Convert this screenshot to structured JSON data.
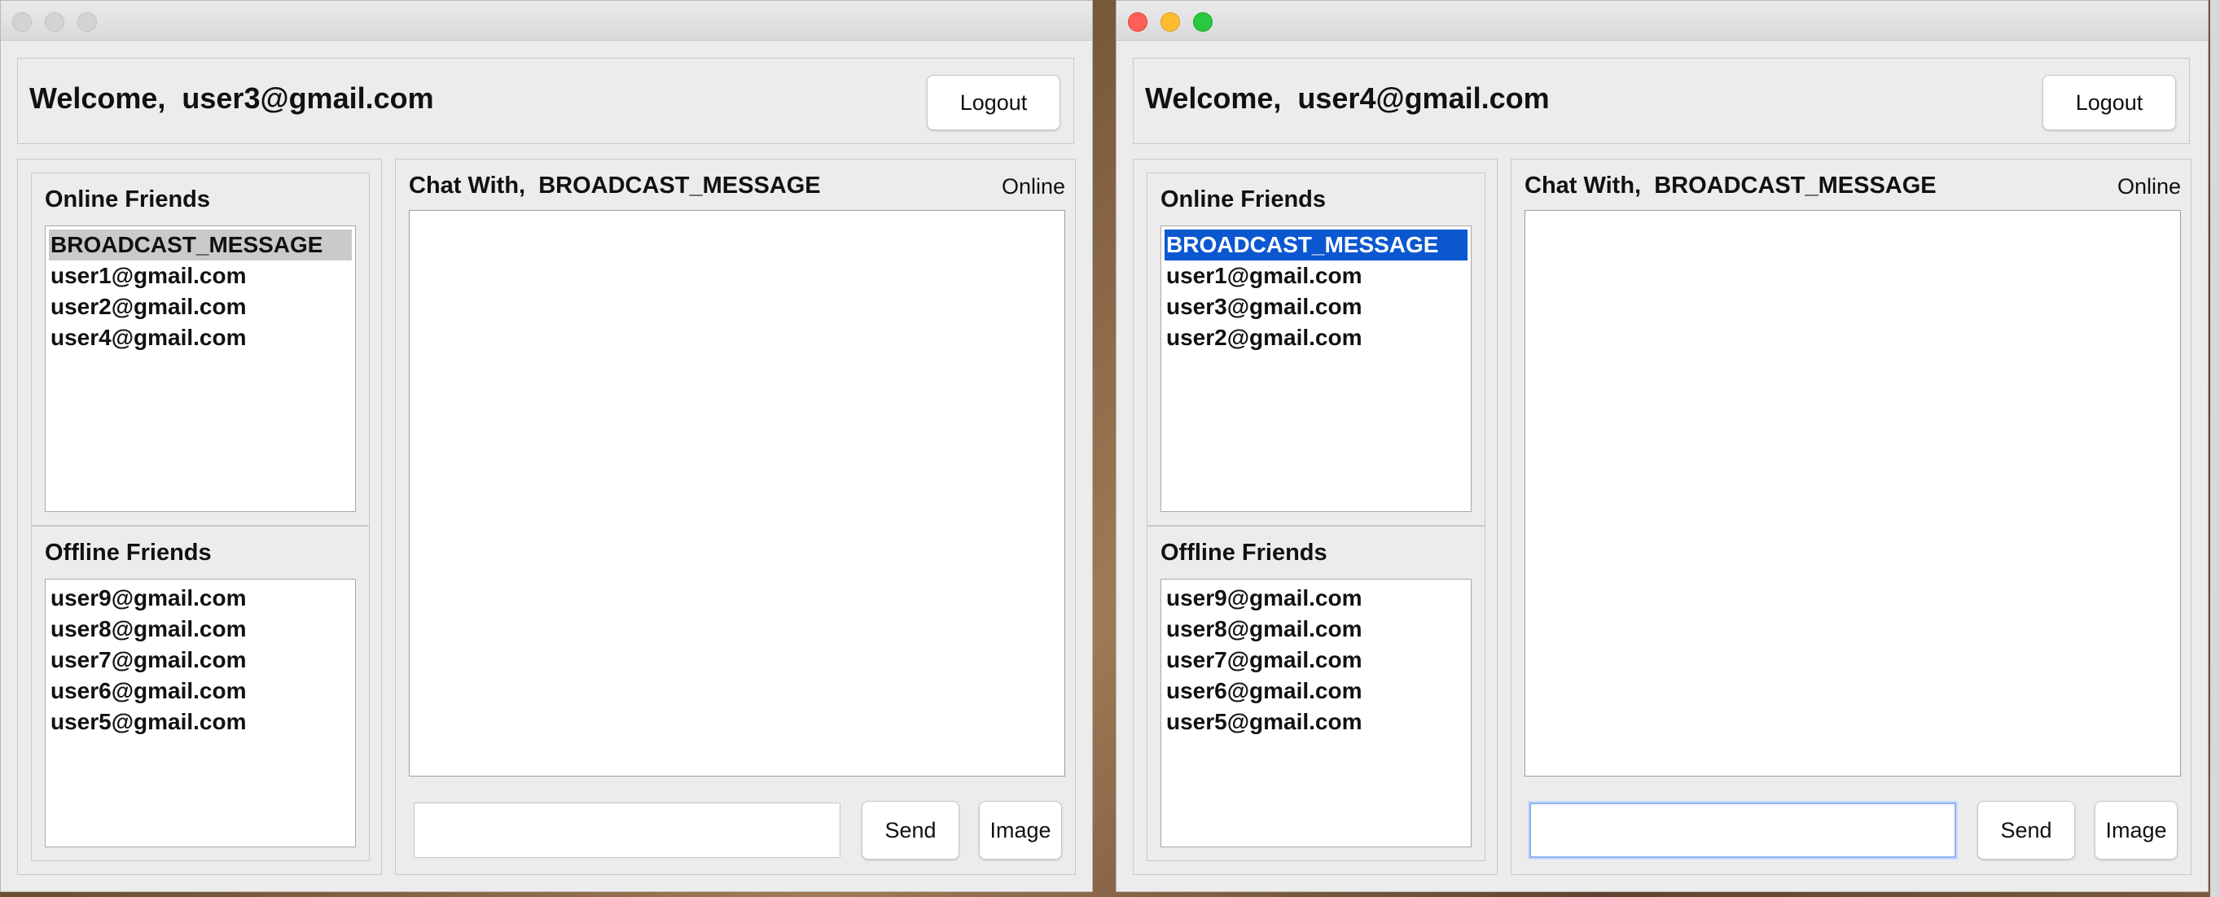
{
  "windows": [
    {
      "welcome": "Welcome,  user3@gmail.com",
      "logout": "Logout",
      "online_title": "Online Friends",
      "online": [
        "BROADCAST_MESSAGE",
        "user1@gmail.com",
        "user2@gmail.com",
        "user4@gmail.com"
      ],
      "offline_title": "Offline Friends",
      "offline": [
        "user9@gmail.com",
        "user8@gmail.com",
        "user7@gmail.com",
        "user6@gmail.com",
        "user5@gmail.com"
      ],
      "chat_title": "Chat With,  BROADCAST_MESSAGE",
      "status": "Online",
      "message_value": "",
      "send": "Send",
      "image": "Image"
    },
    {
      "welcome": "Welcome,  user4@gmail.com",
      "logout": "Logout",
      "online_title": "Online Friends",
      "online": [
        "BROADCAST_MESSAGE",
        "user1@gmail.com",
        "user3@gmail.com",
        "user2@gmail.com"
      ],
      "offline_title": "Offline Friends",
      "offline": [
        "user9@gmail.com",
        "user8@gmail.com",
        "user7@gmail.com",
        "user6@gmail.com",
        "user5@gmail.com"
      ],
      "chat_title": "Chat With,  BROADCAST_MESSAGE",
      "status": "Online",
      "message_value": "",
      "send": "Send",
      "image": "Image"
    }
  ],
  "colors": {
    "selection_active": "#0b57d0",
    "selection_inactive": "#cacaca",
    "close_button": "#fe5f57",
    "minimize_button": "#febc2e",
    "zoom_button": "#28c840"
  }
}
